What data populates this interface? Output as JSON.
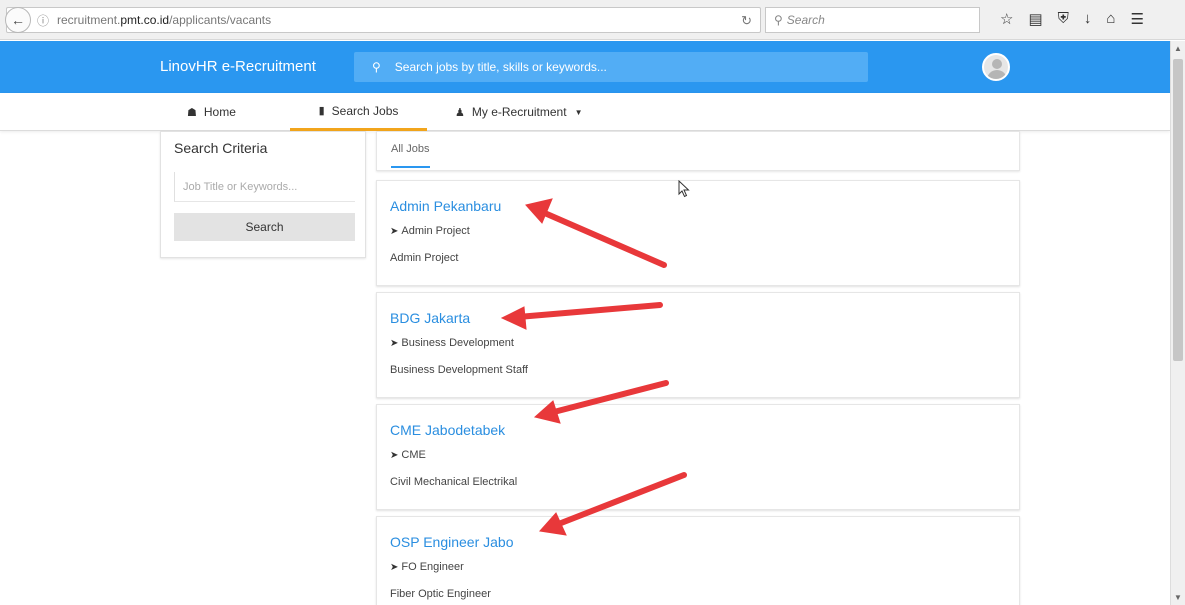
{
  "browser": {
    "url_prefix": "recruitment.",
    "url_domain": "pmt.co.id",
    "url_path": "/applicants/vacants",
    "search_placeholder": "Search"
  },
  "app": {
    "brand": "LinovHR e-Recruitment",
    "search_placeholder": "Search jobs by title, skills or keywords...",
    "accent_color": "#2a97f0",
    "tab_highlight_color": "#f2a51c"
  },
  "nav": {
    "home": "Home",
    "search_jobs": "Search Jobs",
    "my_recruitment": "My e-Recruitment"
  },
  "criteria": {
    "title": "Search Criteria",
    "placeholder": "Job Title or Keywords...",
    "button": "Search"
  },
  "tabs": {
    "all_jobs": "All Jobs"
  },
  "jobs": [
    {
      "title": "Admin Pekanbaru",
      "department": "Admin Project",
      "description": "Admin Project"
    },
    {
      "title": "BDG Jakarta",
      "department": "Business Development",
      "description": "Business Development Staff"
    },
    {
      "title": "CME Jabodetabek",
      "department": "CME",
      "description": "Civil Mechanical Electrikal"
    },
    {
      "title": "OSP Engineer Jabo",
      "department": "FO Engineer",
      "description": "Fiber Optic Engineer"
    }
  ],
  "annotation_color": "#e8383a"
}
